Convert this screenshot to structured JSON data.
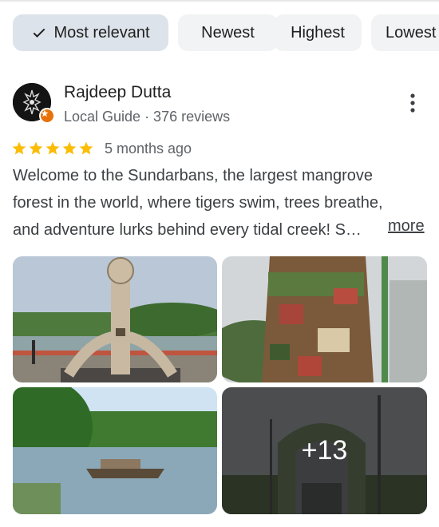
{
  "filters": {
    "chips": [
      {
        "label": "Most relevant",
        "selected": true
      },
      {
        "label": "Newest",
        "selected": false
      },
      {
        "label": "Highest",
        "selected": false
      },
      {
        "label": "Lowest",
        "selected": false
      }
    ]
  },
  "review": {
    "reviewer": {
      "name": "Rajdeep Dutta",
      "meta": "Local Guide · 376 reviews",
      "badge_icon": "local-guide-star-icon"
    },
    "rating": 5,
    "time_ago": "5 months ago",
    "text_lines": [
      "Welcome to the Sundarbans, the largest mangrove",
      "forest in the world, where tigers swim, trees breathe,",
      "and adventure lurks behind every tidal creek! S…"
    ],
    "more_label": "more",
    "photos": {
      "extra_count_label": "+13"
    }
  },
  "colors": {
    "chip_selected": "#dde3ea",
    "chip_default": "#f1f3f4",
    "star": "#fbbc04",
    "badge": "#e8710a"
  }
}
